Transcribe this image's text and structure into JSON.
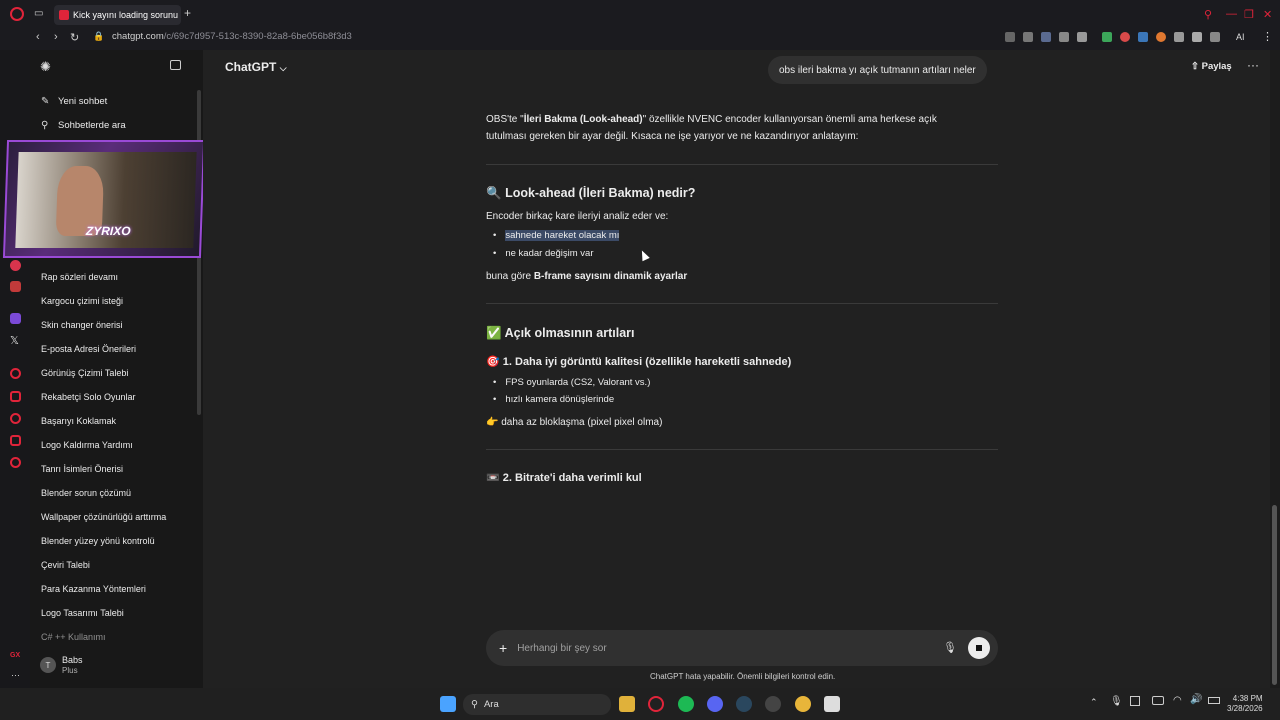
{
  "browser": {
    "tab_title": "Kick yayını loading sorunu",
    "url_host": "chatgpt.com",
    "url_path": "/c/69c7d957-513c-8390-82a8-6be056b8f3d3",
    "ai_label": "AI"
  },
  "sidebar": {
    "new_chat": "Yeni sohbet",
    "search": "Sohbetlerde ara",
    "webcam_tag": "ZYRIXO",
    "history": [
      "Rap sözleri devamı",
      "Kargocu çizimi isteği",
      "Skin changer önerisi",
      "E-posta Adresi Önerileri",
      "Görünüş Çizimi Talebi",
      "Rekabetçi Solo Oyunlar",
      "Başarıyı Koklamak",
      "Logo Kaldırma Yardımı",
      "Tanrı İsimleri Önerisi",
      "Blender sorun çözümü",
      "Wallpaper çözünürlüğü arttırma",
      "Blender yüzey yönü kontrolü",
      "Çeviri Talebi",
      "Para Kazanma Yöntemleri",
      "Logo Tasarımı Talebi",
      "C# ++ Kullanımı"
    ],
    "user": {
      "initial": "T",
      "name": "Babs",
      "plan": "Plus"
    }
  },
  "header": {
    "model": "ChatGPT",
    "share": "Paylaş",
    "user_question": "obs ileri bakma yı açık tutmanın artıları neler"
  },
  "answer": {
    "intro_a": "OBS'te \"",
    "intro_bold": "İleri Bakma (Look-ahead)",
    "intro_b": "\" özellikle NVENC encoder kullanıyorsan önemli ama herkese açık tutulması gereken bir ayar değil. Kısaca ne işe yarıyor ve ne kazandırıyor anlatayım:",
    "h1": "Look-ahead (İleri Bakma) nedir?",
    "h1_icon": "🔍",
    "p1": "Encoder birkaç kare ileriyi analiz eder ve:",
    "list1": [
      "sahnede hareket olacak mı",
      "ne kadar değişim var"
    ],
    "p2_a": "buna göre ",
    "p2_bold": "B-frame sayısını dinamik ayarlar",
    "h2": "Açık olmasının artıları",
    "h2_icon": "✅",
    "h3": "1. Daha iyi görüntü kalitesi (özellikle hareketli sahnede)",
    "h3_icon": "🎯",
    "list2": [
      "FPS oyunlarda (CS2, Valorant vs.)",
      "hızlı kamera dönüşlerinde"
    ],
    "p3": "daha az bloklaşma (pixel pixel olma)",
    "p3_icon": "👉",
    "h4": "2. Bitrate'i daha verimli kul",
    "h4_icon": "📼"
  },
  "composer": {
    "placeholder": "Herhangi bir şey sor",
    "disclaimer": "ChatGPT hata yapabilir. Önemli bilgileri kontrol edin."
  },
  "taskbar": {
    "search": "Ara",
    "time": "4:38 PM",
    "date": "3/28/2026"
  },
  "colors": {
    "accent": "#e0243a",
    "main_bg": "#212121",
    "sidebar_bg": "#181818",
    "highlight": "#3b4a66"
  }
}
